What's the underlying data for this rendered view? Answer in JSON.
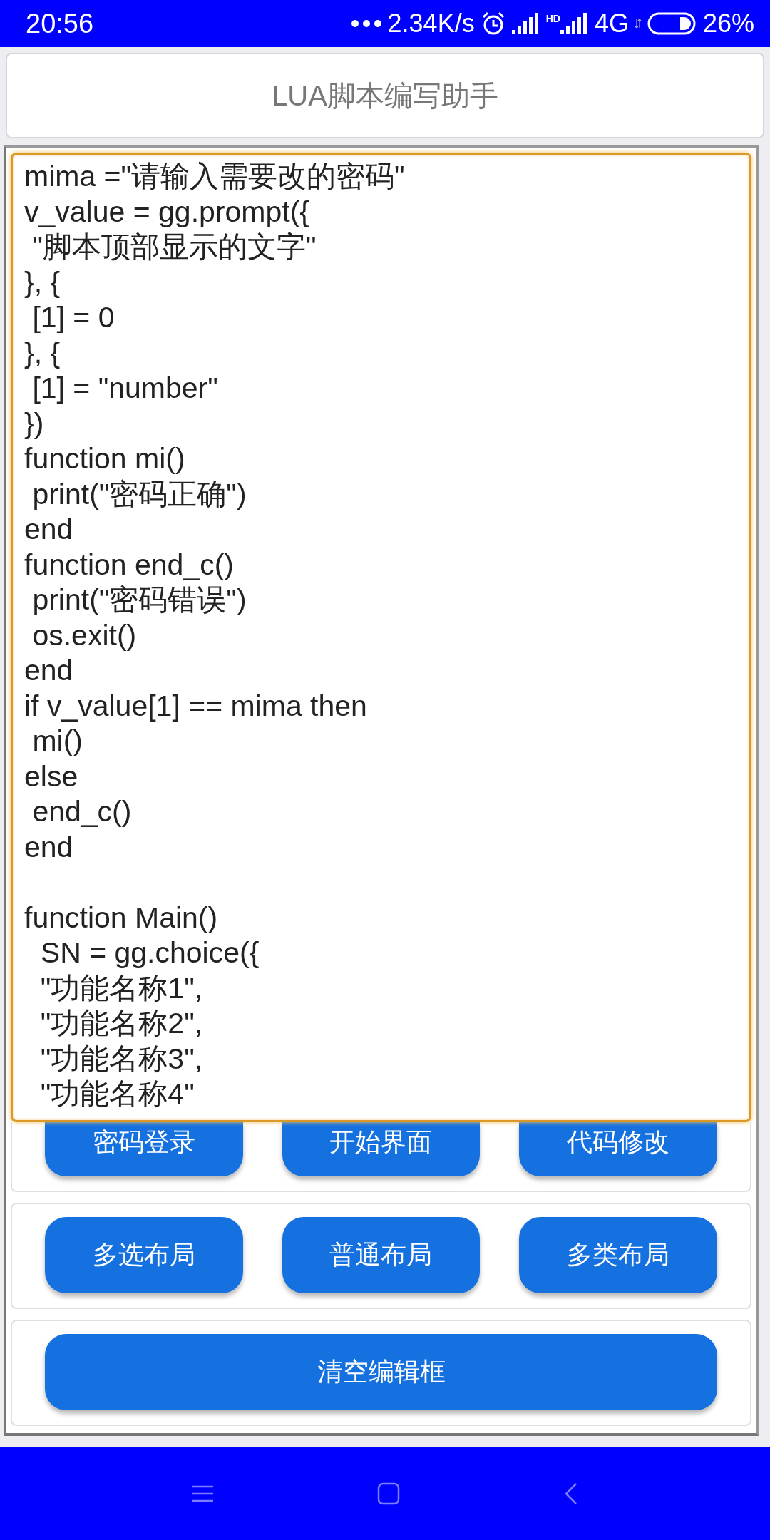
{
  "status_bar": {
    "time": "20:56",
    "speed": "2.34K/s",
    "hd": "HD",
    "network": "4G",
    "battery": "26%"
  },
  "title": "LUA脚本编写助手",
  "editor": {
    "text": "mima =\"请输入需要改的密码\"\nv_value = gg.prompt({\n \"脚本顶部显示的文字\"\n}, {\n [1] = 0\n}, {\n [1] = \"number\"\n})\nfunction mi()\n print(\"密码正确\")\nend\nfunction end_c()\n print(\"密码错误\")\n os.exit()\nend\nif v_value[1] == mima then\n mi()\nelse\n end_c()\nend\n\nfunction Main()\n  SN = gg.choice({\n  \"功能名称1\",\n  \"功能名称2\",\n  \"功能名称3\",\n  \"功能名称4\""
  },
  "button_rows": [
    {
      "buttons": [
        "密码登录",
        "开始界面",
        "代码修改"
      ]
    },
    {
      "buttons": [
        "多选布局",
        "普通布局",
        "多类布局"
      ]
    },
    {
      "buttons": [
        "清空编辑框"
      ]
    }
  ]
}
